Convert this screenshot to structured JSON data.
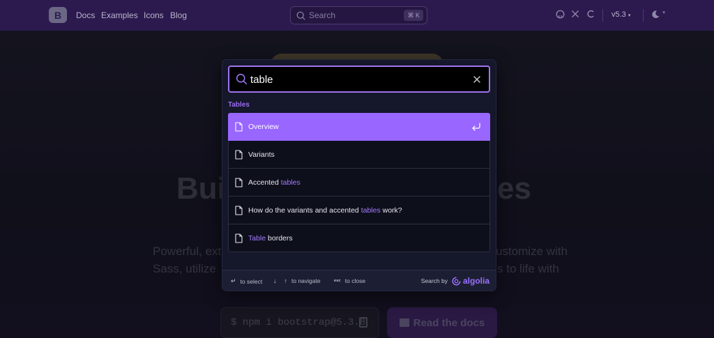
{
  "navbar": {
    "brand": "B",
    "links": [
      "Docs",
      "Examples",
      "Icons",
      "Blog"
    ],
    "search_placeholder": "Search",
    "search_shortcut": "⌘ K",
    "version": "v5.3"
  },
  "hero": {
    "title_left": "Bui",
    "title_right": "ites",
    "text_line1_left": "Powerful, exte",
    "text_line1_right": "ustomize with",
    "text_line2_left": "Sass, utilize",
    "text_line2_right": "s to life with",
    "npm_command": "$ npm i bootstrap@5.3.8",
    "read_button": "Read the docs"
  },
  "search": {
    "query": "table",
    "section": "Tables",
    "results": [
      {
        "before": "Overview",
        "highlight": "",
        "after": "",
        "selected": true
      },
      {
        "before": "Variants",
        "highlight": "",
        "after": "",
        "selected": false
      },
      {
        "before": "Accented ",
        "highlight": "tables",
        "after": "",
        "selected": false
      },
      {
        "before": "How do the variants and accented ",
        "highlight": "tables",
        "after": " work?",
        "selected": false
      },
      {
        "before": "",
        "highlight": "Table",
        "after": " borders",
        "selected": false
      }
    ],
    "footer": {
      "select_label": "to select",
      "navigate_label": "to navigate",
      "close_key": "esc",
      "close_label": "to close",
      "search_by": "Search by",
      "provider": "algolia"
    }
  },
  "colors": {
    "accent": "#9966ff",
    "navbar": "#2c1a4f",
    "modal": "#15172a"
  }
}
